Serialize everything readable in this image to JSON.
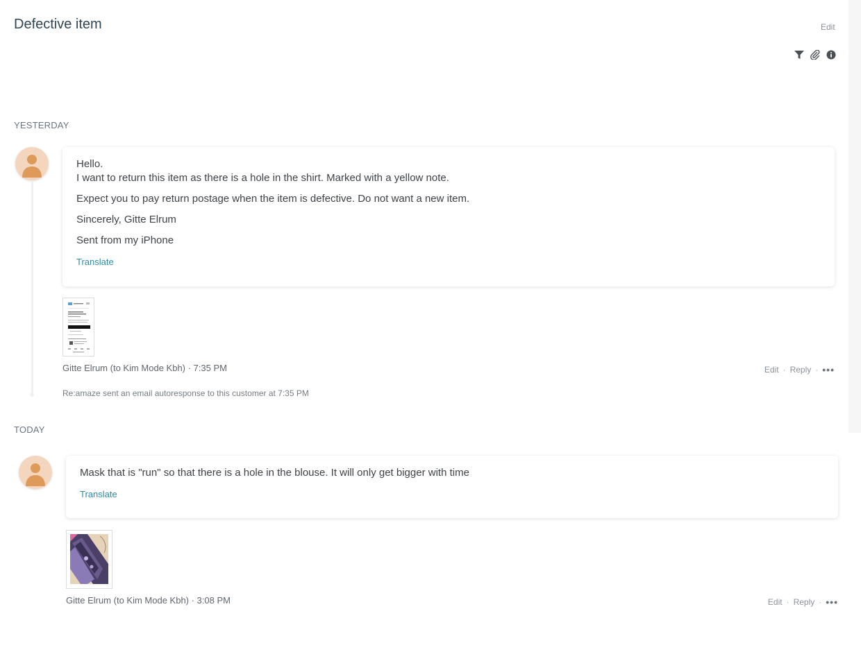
{
  "header": {
    "title": "Defective item",
    "edit_label": "Edit"
  },
  "toolbar": {
    "icons": [
      "filter-icon",
      "paperclip-icon",
      "info-icon"
    ]
  },
  "groups": {
    "yesterday": {
      "label": "YESTERDAY",
      "message": {
        "lines": [
          "Hello.",
          "I want to return this item as there is a hole in the shirt. Marked with a yellow note.",
          "Expect you to pay return postage when the item is defective. Do not want a new item.",
          "Sincerely, Gitte Elrum",
          "Sent from my iPhone"
        ],
        "translate_label": "Translate",
        "meta": "Gitte Elrum (to Kim Mode Kbh) · 7:35 PM",
        "actions": {
          "edit": "Edit",
          "reply": "Reply",
          "sep": "·",
          "more": "•••"
        }
      },
      "autoresponse": "Re:amaze sent an email autoresponse to this customer at 7:35 PM"
    },
    "today": {
      "label": "TODAY",
      "message": {
        "lines": [
          "Mask that is \"run\" so that there is a hole in the blouse. It will only get bigger with time"
        ],
        "translate_label": "Translate",
        "meta": "Gitte Elrum (to Kim Mode Kbh) · 3:08 PM",
        "actions": {
          "edit": "Edit",
          "reply": "Reply",
          "sep": "·",
          "more": "•••"
        }
      }
    }
  },
  "colors": {
    "accent_link": "#2b8ca3",
    "avatar_bg": "#f4d6bf",
    "avatar_fg": "#dd9a59",
    "title": "#2f4553"
  }
}
